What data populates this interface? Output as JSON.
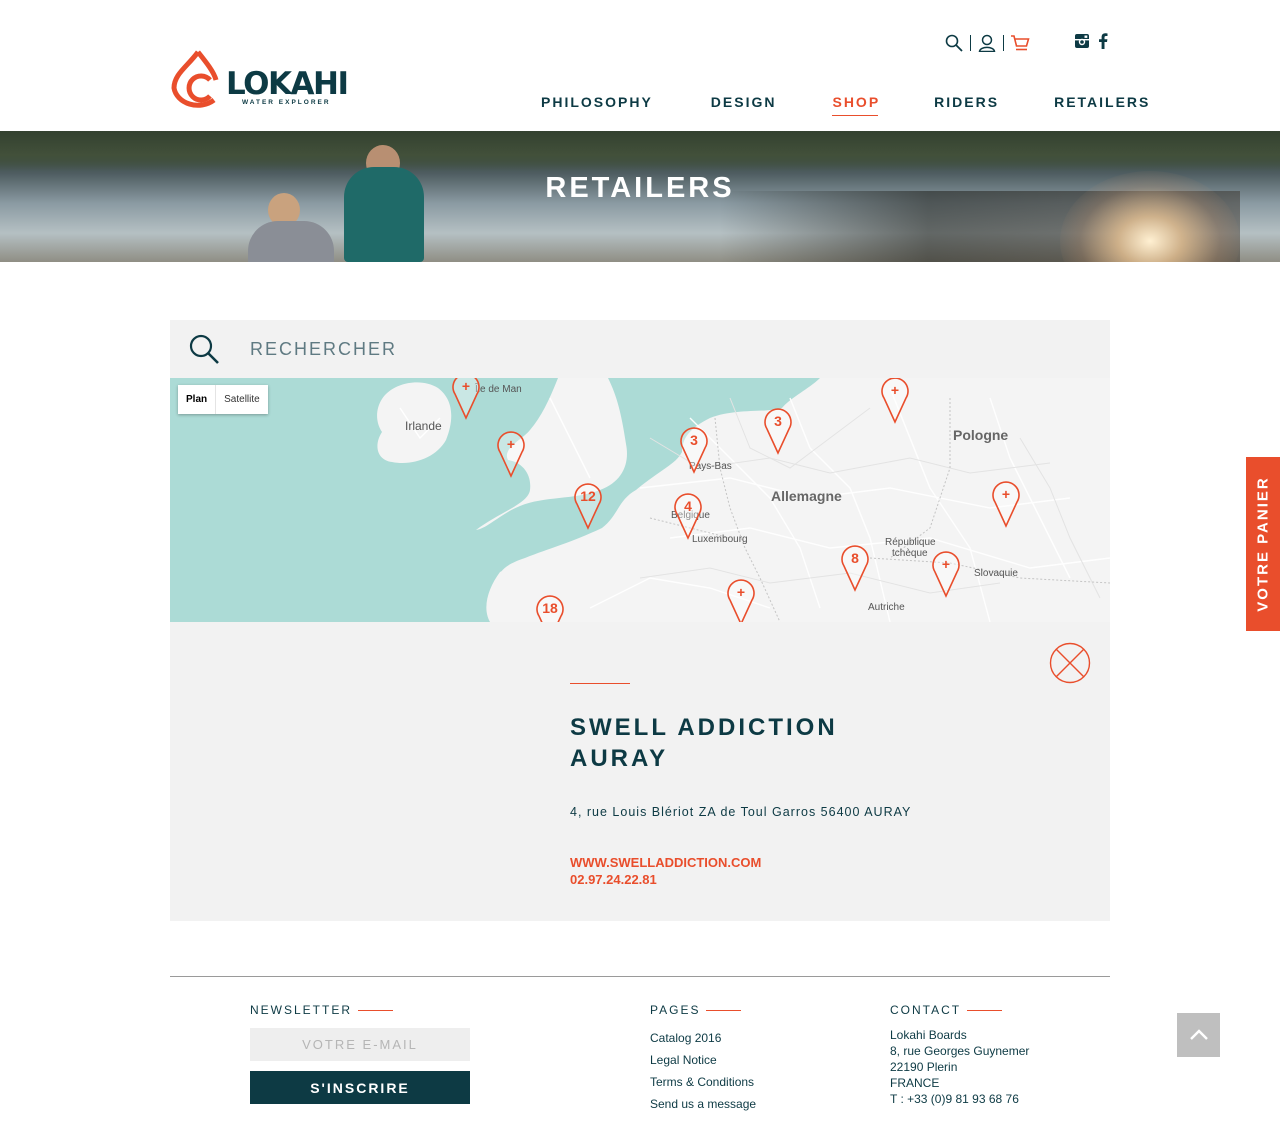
{
  "brand": {
    "name": "LOKAHI",
    "tagline": "WATER EXPLORER",
    "accent": "#e94e2c",
    "dark": "#0d3a44"
  },
  "header": {
    "icons": [
      "search-icon",
      "user-icon",
      "cart-icon"
    ],
    "social": [
      "instagram-icon",
      "facebook-icon"
    ],
    "nav": [
      "PHILOSOPHY",
      "DESIGN",
      "SHOP",
      "RIDERS",
      "RETAILERS"
    ],
    "active_nav": "SHOP"
  },
  "hero": {
    "title": "RETAILERS"
  },
  "search": {
    "placeholder": "RECHERCHER"
  },
  "map": {
    "toggle": {
      "plan": "Plan",
      "satellite": "Satellite"
    },
    "labels": {
      "irlande": "Irlande",
      "ile_de_man": "Île de Man",
      "pays_bas": "Pays-Bas",
      "allemagne": "Allemagne",
      "pologne": "Pologne",
      "belgique": "Belgique",
      "luxembourg": "Luxembourg",
      "republique": "République",
      "tcheque": "tchèque",
      "slovaquie": "Slovaquie",
      "autriche": "Autriche"
    },
    "markers": [
      "+",
      "+",
      "3",
      "3",
      "+",
      "12",
      "4",
      "+",
      "8",
      "+",
      "+",
      "18"
    ]
  },
  "detail": {
    "name_line1": "SWELL ADDICTION",
    "name_line2": "AURAY",
    "address": "4, rue Louis Blériot ZA de Toul Garros 56400 AURAY",
    "website": "WWW.SWELLADDICTION.COM",
    "phone": "02.97.24.22.81"
  },
  "side_tab": {
    "label": "VOTRE PANIER"
  },
  "footer": {
    "newsletter": {
      "heading": "NEWSLETTER",
      "placeholder": "VOTRE E-MAIL",
      "button": "S'INSCRIRE"
    },
    "pages": {
      "heading": "PAGES",
      "links": [
        "Catalog 2016",
        "Legal Notice",
        "Terms & Conditions",
        "Send us a message"
      ]
    },
    "contact": {
      "heading": "CONTACT",
      "lines": [
        "Lokahi Boards",
        "8, rue Georges Guynemer",
        "22190 Plerin",
        "FRANCE",
        "T : +33 (0)9 81 93 68 76"
      ]
    }
  }
}
